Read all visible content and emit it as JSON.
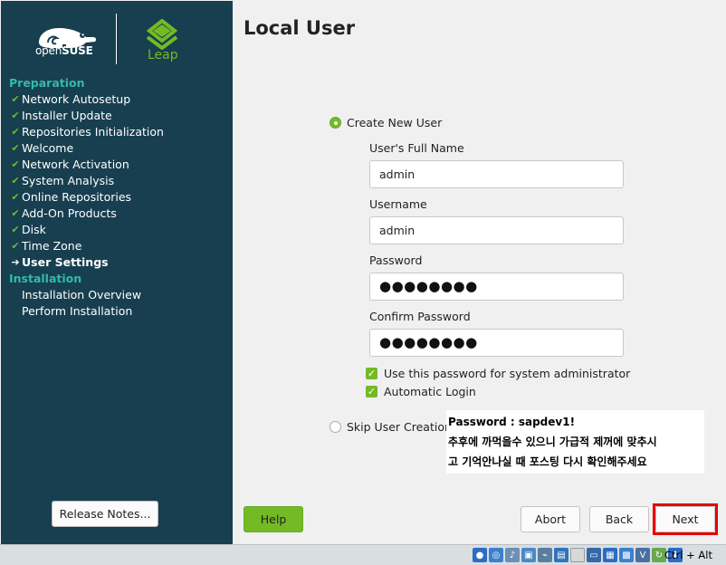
{
  "sidebar": {
    "brand": {
      "opensuse_prefix": "open",
      "opensuse_suffix": "SUSE",
      "leap": "Leap"
    },
    "sections": [
      {
        "title": "Preparation",
        "steps": [
          {
            "label": "Network Autosetup",
            "state": "done"
          },
          {
            "label": "Installer Update",
            "state": "done"
          },
          {
            "label": "Repositories Initialization",
            "state": "done"
          },
          {
            "label": "Welcome",
            "state": "done"
          },
          {
            "label": "Network Activation",
            "state": "done"
          },
          {
            "label": "System Analysis",
            "state": "done"
          },
          {
            "label": "Online Repositories",
            "state": "done"
          },
          {
            "label": "Add-On Products",
            "state": "done"
          },
          {
            "label": "Disk",
            "state": "done"
          },
          {
            "label": "Time Zone",
            "state": "done"
          },
          {
            "label": "User Settings",
            "state": "current"
          }
        ]
      },
      {
        "title": "Installation",
        "steps": [
          {
            "label": "Installation Overview",
            "state": "pending"
          },
          {
            "label": "Perform Installation",
            "state": "pending"
          }
        ]
      }
    ],
    "release_notes_label": "Release Notes..."
  },
  "main": {
    "title": "Local User",
    "create_user_label": "Create New User",
    "full_name_label": "User's Full Name",
    "full_name_value": "admin",
    "username_label": "Username",
    "username_value": "admin",
    "password_label": "Password",
    "password_value": "●●●●●●●●",
    "confirm_password_label": "Confirm Password",
    "confirm_password_value": "●●●●●●●●",
    "use_for_admin_label": "Use this password for system administrator",
    "auto_login_label": "Automatic Login",
    "skip_user_label": "Skip User Creation"
  },
  "note": {
    "line1": "Password : sapdev1!",
    "line2": "추후에 까먹을수 있으니 가급적 제꺼에 맞추시",
    "line3": "고 기억안나실 때 포스팅 다시 확인해주세요"
  },
  "buttons": {
    "help": "Help",
    "abort": "Abort",
    "back": "Back",
    "next": "Next"
  },
  "statusbar": {
    "host_key": "Ctrl + Alt"
  },
  "colors": {
    "sidebar": "#173f4f",
    "accent_green": "#73ba25",
    "section_teal": "#35b9ab",
    "highlight_red": "#e60000"
  }
}
